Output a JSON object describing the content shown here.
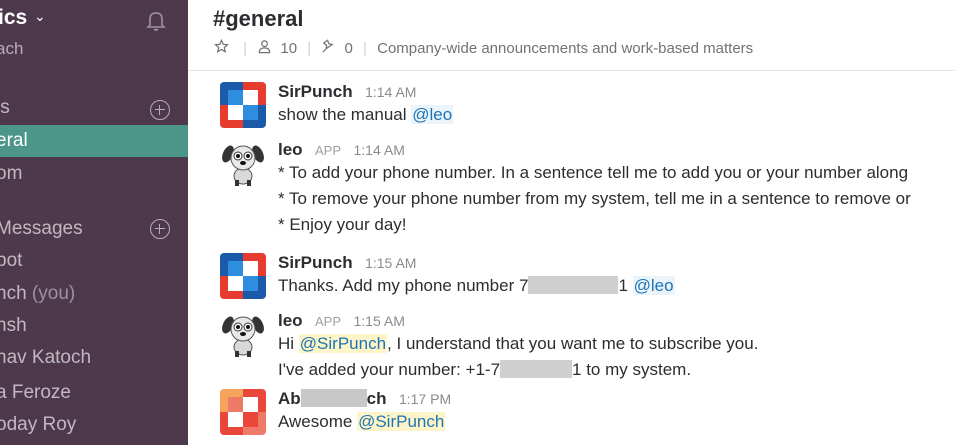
{
  "sidebar": {
    "workspace_name": "ics",
    "user_name": "ach",
    "channels_label": "ls",
    "channels": [
      {
        "label": "eral",
        "active": true
      },
      {
        "label": "om",
        "active": false
      }
    ],
    "dm_label": "Messages",
    "dms": [
      {
        "label": "bot"
      },
      {
        "label": "nch",
        "suffix": "(you)"
      },
      {
        "label": "nsh"
      },
      {
        "label": "hav Katoch"
      },
      {
        "label": "a Feroze"
      },
      {
        "label": "oday Roy"
      }
    ]
  },
  "header": {
    "channel_name": "#general",
    "member_count": "10",
    "pinned_count": "0",
    "topic": "Company-wide announcements and work-based matters"
  },
  "messages": [
    {
      "author": "SirPunch",
      "time": "1:14 AM",
      "text": "show the manual",
      "mention": "@leo"
    },
    {
      "author": "leo",
      "badge": "APP",
      "time": "1:14 AM",
      "lines": [
        "* To add your phone number. In a sentence tell me to add you or your number along",
        "* To remove your phone number from my system, tell me in a sentence to remove or",
        "* Enjoy your day!"
      ]
    },
    {
      "author": "SirPunch",
      "time": "1:15 AM",
      "text_before": "Thanks. Add my phone number 7",
      "text_after": "1",
      "mention": "@leo"
    },
    {
      "author": "leo",
      "badge": "APP",
      "time": "1:15 AM",
      "line1_before": "Hi",
      "line1_mention": "@SirPunch",
      "line1_after": ", I understand that you want me to subscribe you.",
      "line2_before": "I've added your number: +1-7",
      "line2_after": "1 to my system."
    },
    {
      "author_start": "Ab",
      "author_end": "ch",
      "time": "1:17 PM",
      "text": "Awesome",
      "mention": "@SirPunch"
    }
  ],
  "colors": {
    "sidebar_bg": "#4d394b",
    "active_channel": "#4c9689",
    "mention_text": "#1d74b6",
    "self_mention_bg": "#fdf5c8"
  }
}
